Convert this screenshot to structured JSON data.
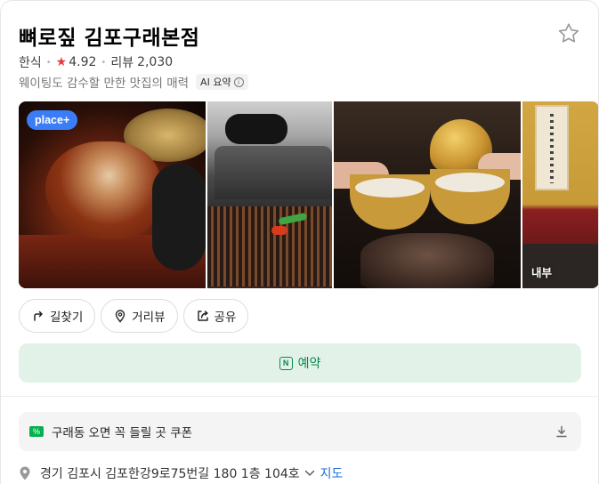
{
  "place": {
    "name": "뼈로짚 김포구래본점",
    "category": "한식",
    "rating": "4.92",
    "review_label": "리뷰",
    "review_count": "2,030",
    "tagline": "웨이팅도 감수할 만한 맛집의 매력",
    "ai_badge": "AI 요약",
    "ai_info": "i"
  },
  "photos": {
    "place_badge": "place+",
    "interior_label": "내부"
  },
  "actions": {
    "directions": "길찾기",
    "streetview": "거리뷰",
    "share": "공유"
  },
  "reserve": {
    "label": "예약",
    "icon_letter": "N"
  },
  "coupon": {
    "text": "구래동 오면 꼭 들릴 곳 쿠폰",
    "icon_text": "%"
  },
  "address": {
    "text": "경기 김포시 김포한강9로75번길 180 1층 104호",
    "map_link": "지도"
  },
  "colors": {
    "accent_green": "#0a8a4c",
    "reserve_bg": "#e2f2e9",
    "rating_star": "#e83b3b",
    "place_plus": "#3b7df6",
    "link_blue": "#1e6fd9"
  }
}
